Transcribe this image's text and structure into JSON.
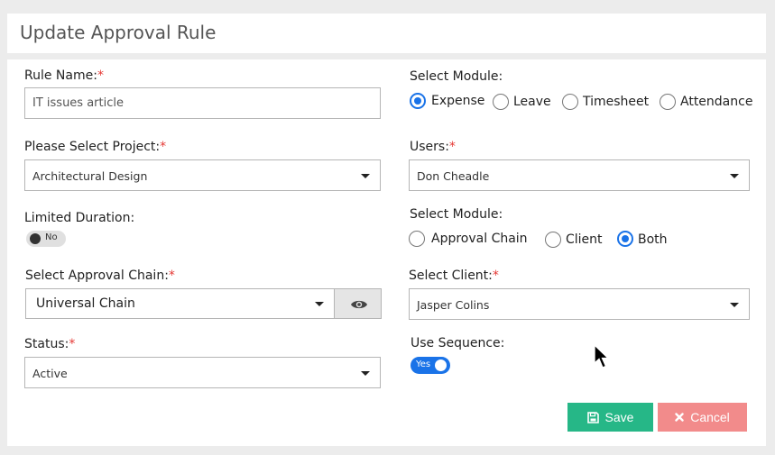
{
  "header": {
    "title": "Update Approval Rule"
  },
  "form": {
    "rule_name": {
      "label": "Rule Name:",
      "required": "*",
      "value": "IT issues article"
    },
    "select_module_1": {
      "label": "Select Module:",
      "options": [
        "Expense",
        "Leave",
        "Timesheet",
        "Attendance"
      ],
      "selected": "Expense"
    },
    "project": {
      "label": "Please Select Project:",
      "required": "*",
      "value": "Architectural Design"
    },
    "users": {
      "label": "Users:",
      "required": "*",
      "value": "Don Cheadle"
    },
    "limited_duration": {
      "label": "Limited Duration:",
      "toggle_text": "No",
      "enabled": false
    },
    "select_module_2": {
      "label": "Select Module:",
      "options": [
        "Approval Chain",
        "Client",
        "Both"
      ],
      "selected": "Both"
    },
    "approval_chain": {
      "label": "Select Approval Chain:",
      "required": "*",
      "value": "Universal Chain",
      "icon": "eye-icon"
    },
    "client": {
      "label": "Select Client:",
      "required": "*",
      "value": "Jasper Colins"
    },
    "status": {
      "label": "Status:",
      "required": "*",
      "value": "Active"
    },
    "use_sequence": {
      "label": "Use Sequence:",
      "toggle_text": "Yes",
      "enabled": true
    }
  },
  "actions": {
    "save_label": "Save",
    "save_icon": "save-icon",
    "cancel_label": "Cancel",
    "cancel_icon": "close-icon"
  },
  "colors": {
    "primary": "#1a73e8",
    "save": "#26b787",
    "cancel": "#f28b8b",
    "required": "#e53935"
  }
}
